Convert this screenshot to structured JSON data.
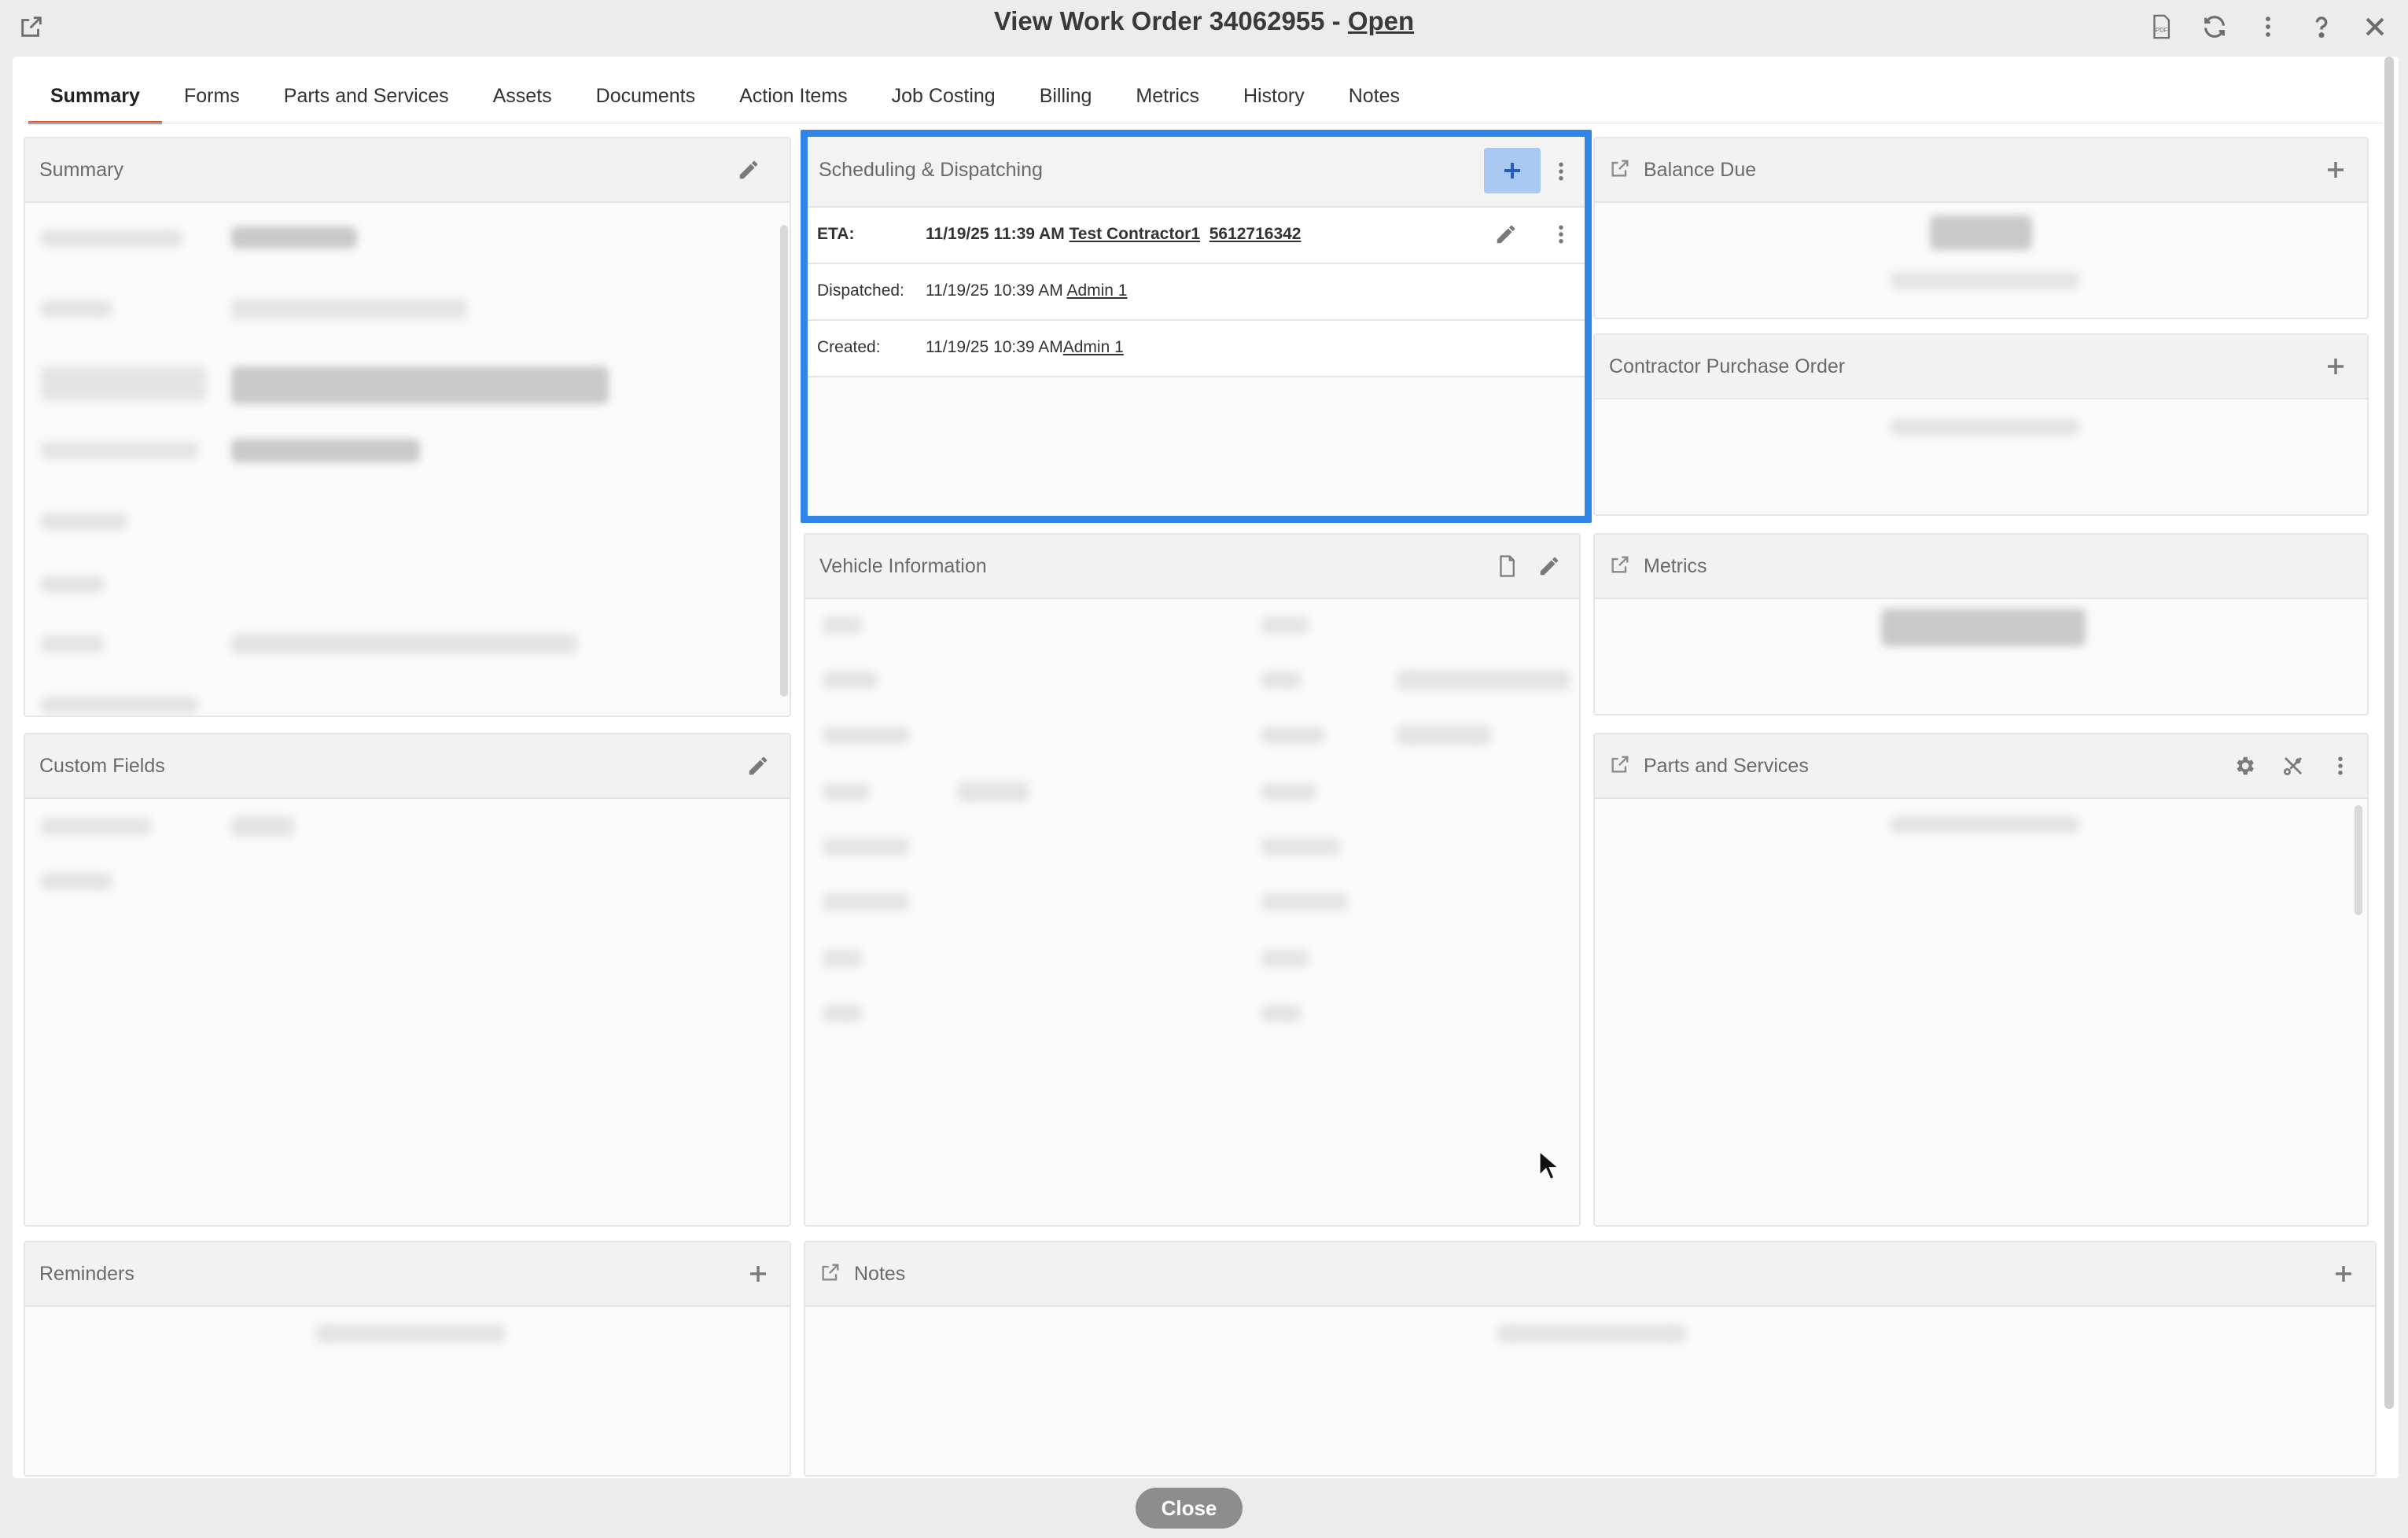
{
  "window": {
    "title": "View Work Order  34062955  -",
    "status": "Open"
  },
  "tabs": [
    "Summary",
    "Forms",
    "Parts and Services",
    "Assets",
    "Documents",
    "Action Items",
    "Job Costing",
    "Billing",
    "Metrics",
    "History",
    "Notes"
  ],
  "panels": {
    "summary": "Summary",
    "custom_fields": "Custom Fields",
    "reminders": "Reminders",
    "scheduling": "Scheduling & Dispatching",
    "vehicle": "Vehicle Information",
    "notes": "Notes",
    "balance_due": "Balance Due",
    "contractor_po": "Contractor Purchase Order",
    "metrics": "Metrics",
    "parts_services": "Parts and Services"
  },
  "scheduling_rows": [
    {
      "label": "ETA:",
      "datetime": "11/19/25 11:39 AM",
      "name": "Test Contractor1",
      "phone": "5612716342"
    },
    {
      "label": "Dispatched:",
      "datetime": "11/19/25 10:39 AM",
      "name": "Admin 1"
    },
    {
      "label": "Created:",
      "datetime": "11/19/25 10:39 AM",
      "name": "Admin 1"
    }
  ],
  "footer": {
    "close_label": "Close"
  },
  "icons": {
    "window_left": "external-link-icon",
    "toolbar": [
      "pdf-icon",
      "refresh-icon",
      "more-vertical-icon",
      "help-icon",
      "close-icon"
    ]
  },
  "colors": {
    "accent_tab": "#e0552a",
    "highlight": "#2f86e8",
    "add_button": "#a9c8f2"
  }
}
